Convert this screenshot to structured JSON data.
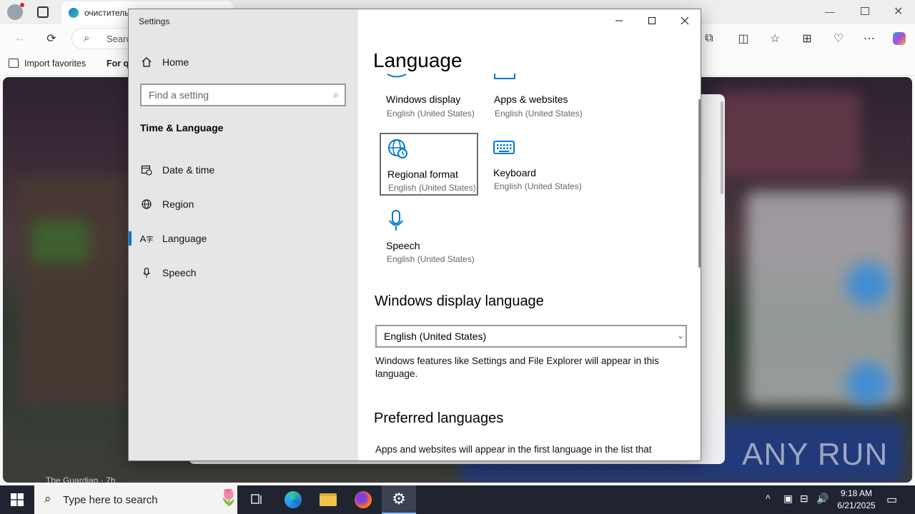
{
  "browser": {
    "tabs": [
      {
        "label": "очиститель",
        "icon": "edge-tab-icon"
      }
    ],
    "address_placeholder": "Search",
    "favorites": [
      {
        "label": "Import favorites"
      },
      {
        "label": "For qu"
      }
    ],
    "feed_source": "The Guardian · 7h"
  },
  "settings": {
    "window_title": "Settings",
    "search_placeholder": "Find a setting",
    "nav": {
      "home": "Home",
      "category": "Time & Language",
      "items": [
        {
          "label": "Date & time",
          "icon": "calendar-clock-icon"
        },
        {
          "label": "Region",
          "icon": "globe-icon"
        },
        {
          "label": "Language",
          "icon": "language-icon",
          "selected": true
        },
        {
          "label": "Speech",
          "icon": "microphone-icon"
        }
      ]
    },
    "page_title": "Language",
    "tiles": [
      {
        "name": "Windows display",
        "sub": "English (United States)",
        "icon": "monitor-icon"
      },
      {
        "name": "Apps & websites",
        "sub": "English (United States)",
        "icon": "window-icon"
      },
      {
        "name": "Regional format",
        "sub": "English (United States)",
        "icon": "globe-clock-icon",
        "selected": true
      },
      {
        "name": "Keyboard",
        "sub": "English (United States)",
        "icon": "keyboard-icon"
      },
      {
        "name": "Speech",
        "sub": "English (United States)",
        "icon": "microphone-icon"
      }
    ],
    "display_language": {
      "heading": "Windows display language",
      "selected": "English (United States)",
      "description": "Windows features like Settings and File Explorer will appear in this language."
    },
    "preferred": {
      "heading": "Preferred languages",
      "description": "Apps and websites will appear in the first language in the list that"
    },
    "accent_color": "#0078d4"
  },
  "taskbar": {
    "search_placeholder": "Type here to search",
    "apps": [
      "task-view-icon",
      "edge-icon",
      "file-explorer-icon",
      "firefox-icon",
      "settings-icon"
    ],
    "time": "9:18 AM",
    "date": "6/21/2025"
  },
  "watermark": "ANY RUN"
}
